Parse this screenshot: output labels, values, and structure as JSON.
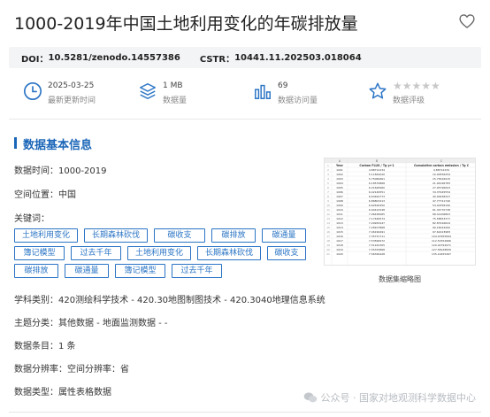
{
  "page": {
    "title": "1000-2019年中国土地利用变化的年碳排放量"
  },
  "identifiers": {
    "doi_label": "DOI：",
    "doi_value": "10.5281/zenodo.14557386",
    "cstr_label": "CSTR：",
    "cstr_value": "10441.11.202503.018064"
  },
  "stats": [
    {
      "icon": "clock-icon",
      "value": "2025-03-25",
      "label": "最新更新时间"
    },
    {
      "icon": "database-icon",
      "value": "1 MB",
      "label": "数据量"
    },
    {
      "icon": "bar-chart-icon",
      "value": "69",
      "label": "数据访问量"
    },
    {
      "icon": "star-badge-icon",
      "value": "★★★★★",
      "label": "数据评级"
    }
  ],
  "section": {
    "title": "数据基本信息"
  },
  "info": {
    "time_label": "数据时间：",
    "time_value": "1000-2019",
    "space_label": "空间位置：",
    "space_value": "中国",
    "keywords_label": "关键词：",
    "subject_label": "学科类别：",
    "subject_value": "420测绘科学技术 - 420.30地图制图技术 - 420.3040地理信息系统",
    "theme_label": "主题分类：",
    "theme_value": "其他数据 - 地面监测数据 - -",
    "count_label": "数据条目：",
    "count_value": "1 条",
    "resolution_label": "数据分辨率：",
    "resolution_value": "空间分辨率：省",
    "type_label": "数据类型：",
    "type_value": "属性表格数据"
  },
  "keywords": [
    "土地利用变化",
    "长期森林砍伐",
    "碳收支",
    "碳排放",
    "碳通量",
    "簿记模型",
    "过去千年",
    "土地利用变化",
    "长期森林砍伐",
    "碳收支",
    "碳排放",
    "碳通量",
    "簿记模型",
    "过去千年"
  ],
  "thumbnail": {
    "caption": "数据集缩略图",
    "col_headers": [
      "A",
      "B",
      "C"
    ],
    "header_row": [
      "Year",
      "Carbon FLUX / Tg yr-1",
      "Cumulative carbon emission / Tg C"
    ],
    "rows": [
      [
        "1001",
        "4.88712234",
        "4.88712234"
      ],
      [
        "1002",
        "5.11844020",
        "10.00556254"
      ],
      [
        "1003",
        "5.75060661",
        "15.75616915"
      ],
      [
        "1004",
        "6.18579868",
        "21.94196783"
      ],
      [
        "1005",
        "6.21626960",
        "27.95796003"
      ],
      [
        "1006",
        "6.42149551",
        "34.37945554"
      ],
      [
        "1007",
        "6.63492773",
        "40.90938327"
      ],
      [
        "1008",
        "6.86803413",
        "47.77741740"
      ],
      [
        "1009",
        "6.62616450",
        "54.40358190"
      ],
      [
        "1010",
        "6.94412548",
        "61.34770738"
      ],
      [
        "1011",
        "7.06436065",
        "68.41206803"
      ],
      [
        "1012",
        "7.17446574",
        "75.58653377"
      ],
      [
        "1013",
        "7.29263247",
        "82.87916624"
      ],
      [
        "1014",
        "7.28107868",
        "90.16024492"
      ],
      [
        "1015",
        "7.46199491",
        "97.62223983"
      ],
      [
        "1016",
        "7.35731711",
        "104.97955694"
      ],
      [
        "1017",
        "7.53596972",
        "112.51552666"
      ],
      [
        "1018",
        "7.51242305",
        "120.02794971"
      ],
      [
        "1019",
        "7.55333868",
        "127.58128839"
      ],
      [
        "1020",
        "7.56326428",
        "135.14455267"
      ]
    ]
  },
  "watermark": {
    "text": "公众号 · 国家对地观测科学数据中心"
  },
  "colors": {
    "accent": "#1b66b8",
    "tag_border": "#2a74c5"
  }
}
